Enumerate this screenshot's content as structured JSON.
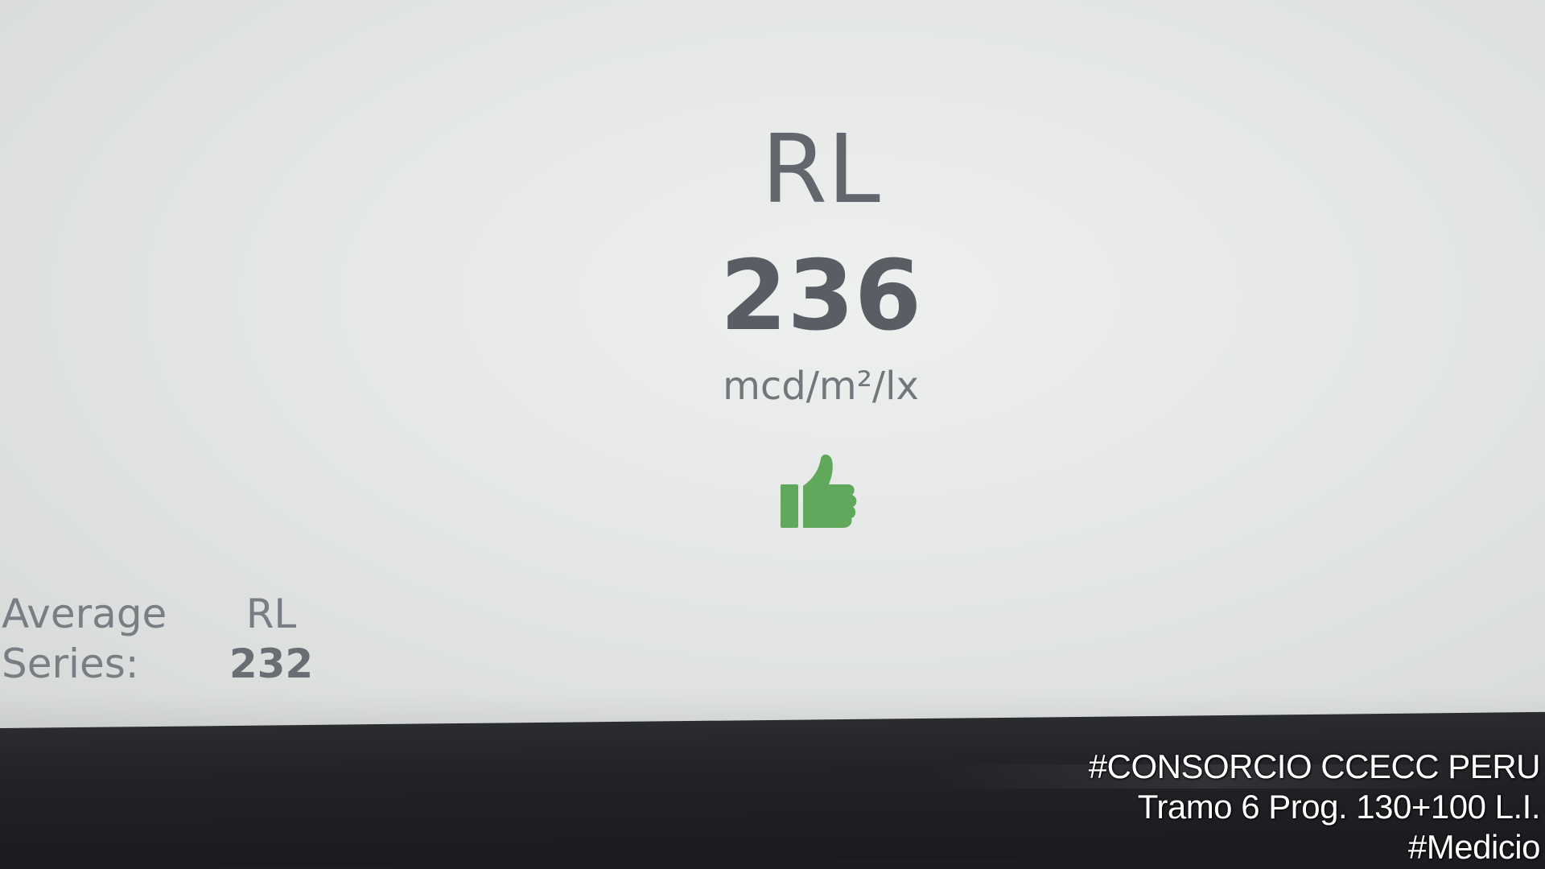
{
  "reading": {
    "label": "RL",
    "value": "236",
    "unit": "mcd/m²/lx",
    "status_icon": "thumbs-up-icon",
    "status_color": "#5fa85c"
  },
  "average": {
    "line1_key": "Average",
    "line1_val": "RL",
    "line2_key": "Series:",
    "line2_val": "232"
  },
  "watermark": {
    "line1": "#CONSORCIO CCECC PERU",
    "line2": "Tramo 6 Prog. 130+100 L.I.",
    "line3": "#Medicio"
  }
}
